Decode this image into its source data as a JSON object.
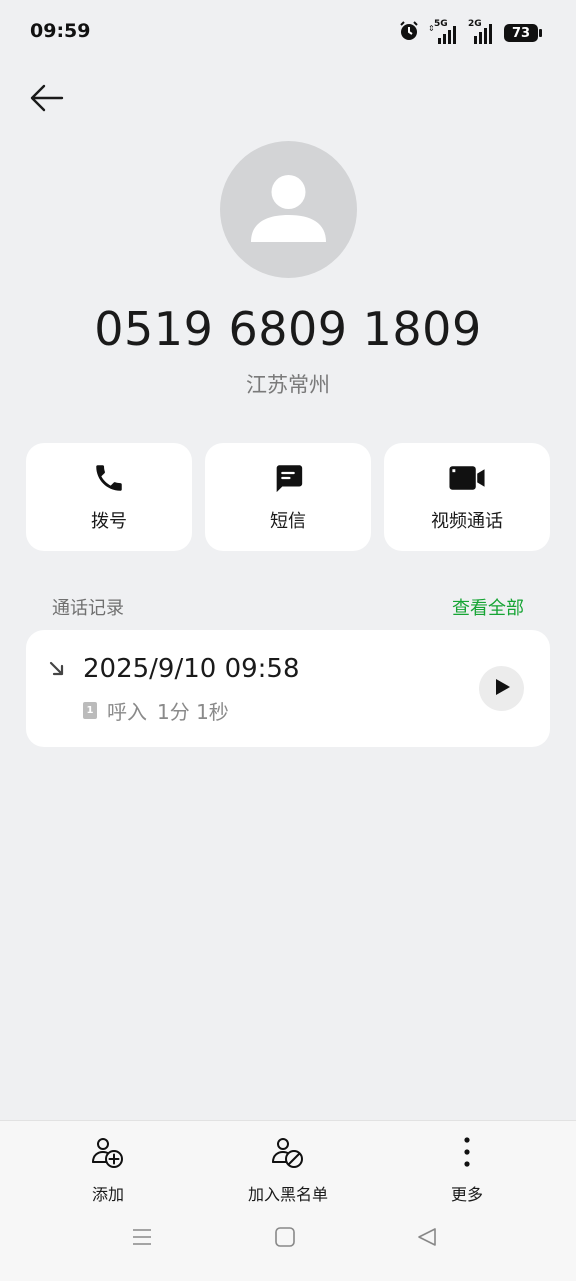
{
  "status_bar": {
    "time": "09:59",
    "network_5g": "5G",
    "network_2g": "2G",
    "battery": "73",
    "icons": [
      "alarm-icon",
      "signal-5g-icon",
      "signal-2g-icon",
      "battery-icon"
    ]
  },
  "header": {
    "back_icon": "arrow-left-icon"
  },
  "contact": {
    "avatar_icon": "person-silhouette-icon",
    "phone_number": "0519 6809 1809",
    "location": "江苏常州"
  },
  "actions": [
    {
      "label": "拨号",
      "icon": "phone-icon"
    },
    {
      "label": "短信",
      "icon": "message-icon"
    },
    {
      "label": "视频通话",
      "icon": "video-camera-icon"
    }
  ],
  "call_log": {
    "title": "通话记录",
    "view_all": "查看全部",
    "entry": {
      "datetime": "2025/9/10 09:58",
      "sim": "1",
      "direction": "呼入",
      "duration": "1分 1秒",
      "direction_icon": "incoming-arrow-icon",
      "play_icon": "play-icon"
    }
  },
  "bottom_actions": [
    {
      "label": "添加",
      "icon": "add-contact-icon"
    },
    {
      "label": "加入黑名单",
      "icon": "block-contact-icon"
    },
    {
      "label": "更多",
      "icon": "more-vertical-icon"
    }
  ],
  "nav": [
    "menu-icon",
    "home-icon",
    "back-triangle-icon"
  ],
  "colors": {
    "accent": "#16a434",
    "background": "#eff0f2",
    "card": "#ffffff",
    "avatar_bg": "#d3d4d6"
  }
}
